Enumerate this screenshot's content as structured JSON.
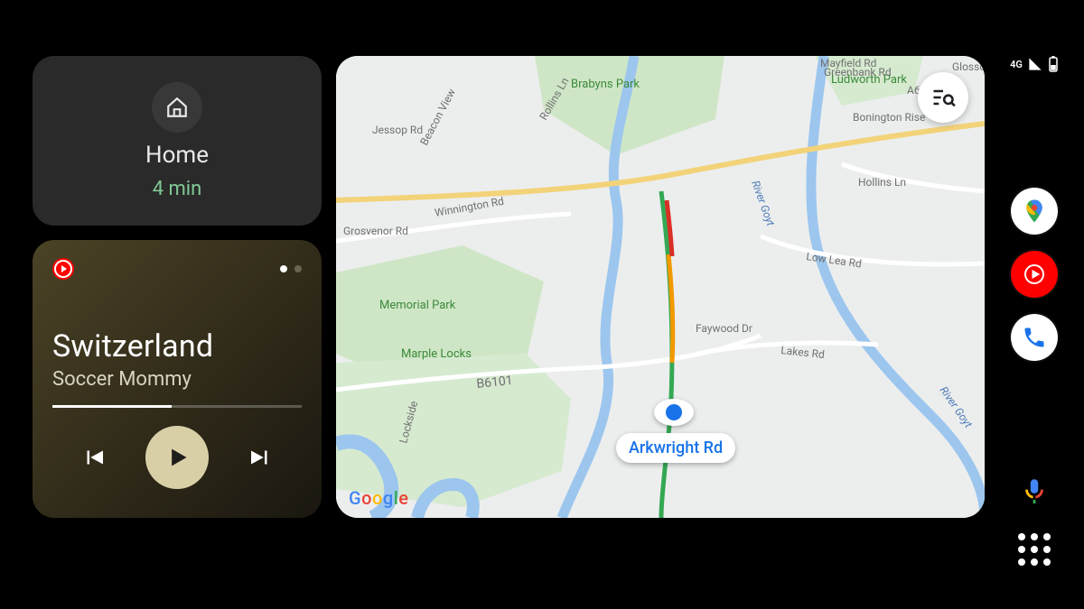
{
  "nav_card": {
    "destination": "Home",
    "eta": "4 min"
  },
  "music": {
    "track_title": "Switzerland",
    "artist": "Soccer Mommy",
    "progress_pct": 48,
    "pager_active": 0,
    "pager_count": 2
  },
  "map": {
    "attribution": "Google",
    "current_street": "Arkwright Rd",
    "labels": {
      "brabyns_park": "Brabyns Park",
      "memorial_park": "Memorial Park",
      "marple_locks": "Marple Locks",
      "ludworth_park": "Ludworth Park",
      "beacon_view": "Beacon View",
      "jessop_rd": "Jessop Rd",
      "rollins": "Rollins Ln",
      "winnington_rd": "Winnington Rd",
      "grosvenor_rd": "Grosvenor Rd",
      "low_lea_rd": "Low Lea Rd",
      "hollins_ln": "Hollins Ln",
      "faywood_dr": "Faywood Dr",
      "lakes_rd": "Lakes Rd",
      "b6101": "B6101",
      "lockside": "Lockside",
      "river_goyt": "River Goyt",
      "river_goyt2": "River Goyt",
      "mayfield_rd": "Mayfield Rd",
      "greenbank_rd": "Greenbank Rd",
      "a626": "A626",
      "bonington": "Bonington Rise",
      "glosso": "Glosso"
    }
  },
  "status_bar": {
    "network": "4G"
  },
  "rail": {
    "apps": [
      "maps",
      "youtube-music",
      "phone"
    ],
    "assistant": "assistant",
    "launcher": "app-grid"
  }
}
